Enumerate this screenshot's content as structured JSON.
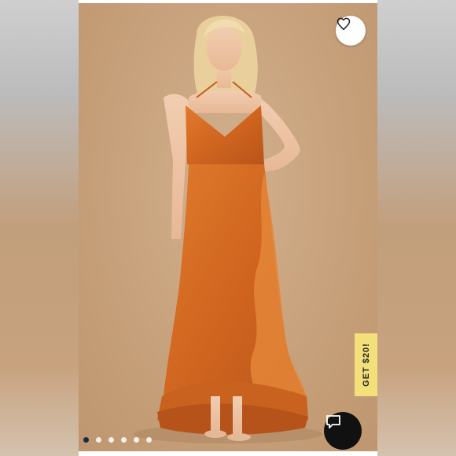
{
  "promo": {
    "label": "GET $20!"
  },
  "gallery": {
    "slide_count": 6,
    "active_index": 0
  },
  "icons": {
    "like": "heart-outline-icon",
    "chat": "chat-bubble-icon"
  },
  "colors": {
    "dress": "#d36a22",
    "promo_background": "#f3e07a",
    "chat_button": "#111111",
    "active_dot": "#1a2b4a"
  }
}
